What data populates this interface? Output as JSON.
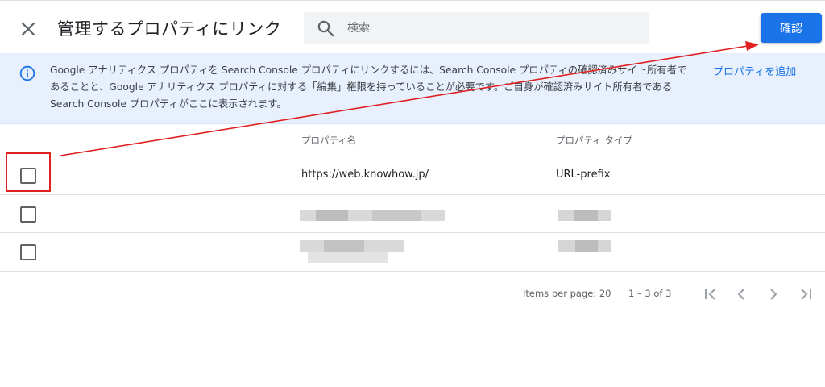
{
  "header": {
    "title": "管理するプロパティにリンク",
    "search_placeholder": "検索",
    "confirm_label": "確認"
  },
  "banner": {
    "message": "Google アナリティクス プロパティを Search Console プロパティにリンクするには、Search Console プロパティの確認済みサイト所有者であることと、Google アナリティクス プロパティに対する「編集」権限を持っていることが必要です。ご自身が確認済みサイト所有者である Search Console プロパティがここに表示されます。",
    "add_property_label": "プロパティを追加"
  },
  "table": {
    "columns": [
      "プロパティ名",
      "プロパティ タイプ"
    ],
    "rows": [
      {
        "name": "https://web.knowhow.jp/",
        "type": "URL-prefix",
        "checked": false
      },
      {
        "name": "",
        "type": "",
        "checked": false,
        "redacted": true
      },
      {
        "name": "",
        "type": "",
        "checked": false,
        "redacted": true
      }
    ]
  },
  "pagination": {
    "items_per_page": "Items per page: 20",
    "range": "1 – 3 of 3"
  },
  "colors": {
    "accent": "#1a73e8",
    "banner_bg": "#e8f0fe",
    "annotation_red": "#e02020"
  },
  "icons": [
    "close-icon",
    "search-icon",
    "info-icon",
    "checkbox-icon",
    "first-page-icon",
    "prev-page-icon",
    "next-page-icon",
    "last-page-icon"
  ]
}
